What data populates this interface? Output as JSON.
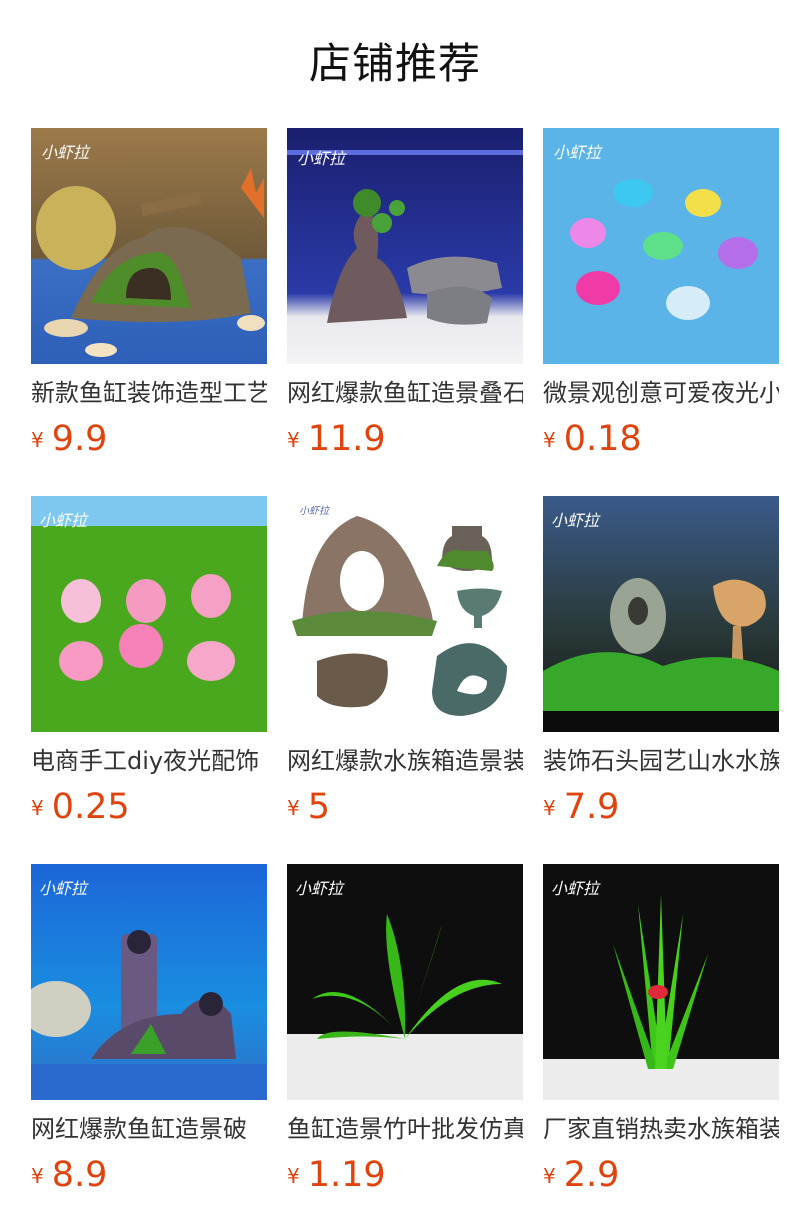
{
  "page": {
    "title": "店铺推荐",
    "currency": "¥",
    "accent_color": "#e0440e"
  },
  "products": [
    {
      "name": "新款鱼缸装饰造型工艺",
      "price": "9.9",
      "image": "aquarium-ruin-bridge-decor"
    },
    {
      "name": "网红爆款鱼缸造景叠石",
      "price": "11.9",
      "image": "driftwood-tree-rock-decor"
    },
    {
      "name": "微景观创意可爱夜光小",
      "price": "0.18",
      "image": "glow-dolphin-figures"
    },
    {
      "name": "电商手工diy夜光配饰",
      "price": "0.25",
      "image": "glow-pig-figures"
    },
    {
      "name": "网红爆款水族箱造景装",
      "price": "5",
      "image": "vase-ruin-ornaments"
    },
    {
      "name": "装饰石头园艺山水水族",
      "price": "7.9",
      "image": "stone-garden-aquascape"
    },
    {
      "name": "网红爆款鱼缸造景破",
      "price": "8.9",
      "image": "broken-pipe-ruin-decor"
    },
    {
      "name": "鱼缸造景竹叶批发仿真",
      "price": "1.19",
      "image": "fern-artificial-plant"
    },
    {
      "name": "厂家直销热卖水族箱装",
      "price": "2.9",
      "image": "grass-plant-with-fish"
    }
  ]
}
